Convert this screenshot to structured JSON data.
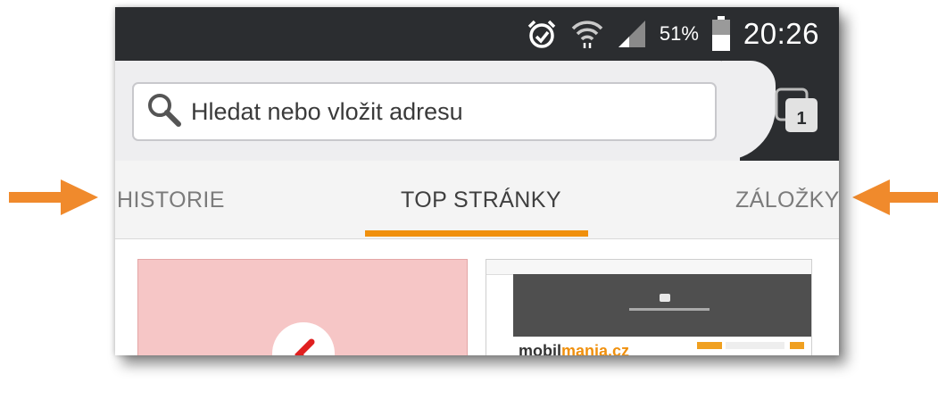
{
  "status_bar": {
    "battery_percent": "51%",
    "time": "20:26",
    "icons": [
      "alarm-icon",
      "wifi-icon",
      "signal-icon",
      "battery-icon"
    ]
  },
  "toolbar": {
    "search_placeholder": "Hledat nebo vložit adresu",
    "tab_count": "1"
  },
  "tabs": [
    {
      "label": "HISTORIE",
      "active": false
    },
    {
      "label": "TOP STRÁNKY",
      "active": true
    },
    {
      "label": "ZÁLOŽKY",
      "active": false
    }
  ],
  "thumbnail_text": {
    "site_logo_left": "mobil",
    "site_logo_right": "mania.cz"
  },
  "colors": {
    "accent": "#f0900d",
    "arrow": "#f08a2c",
    "statusbar": "#2b2d30",
    "toolbar": "#eeeef0"
  }
}
